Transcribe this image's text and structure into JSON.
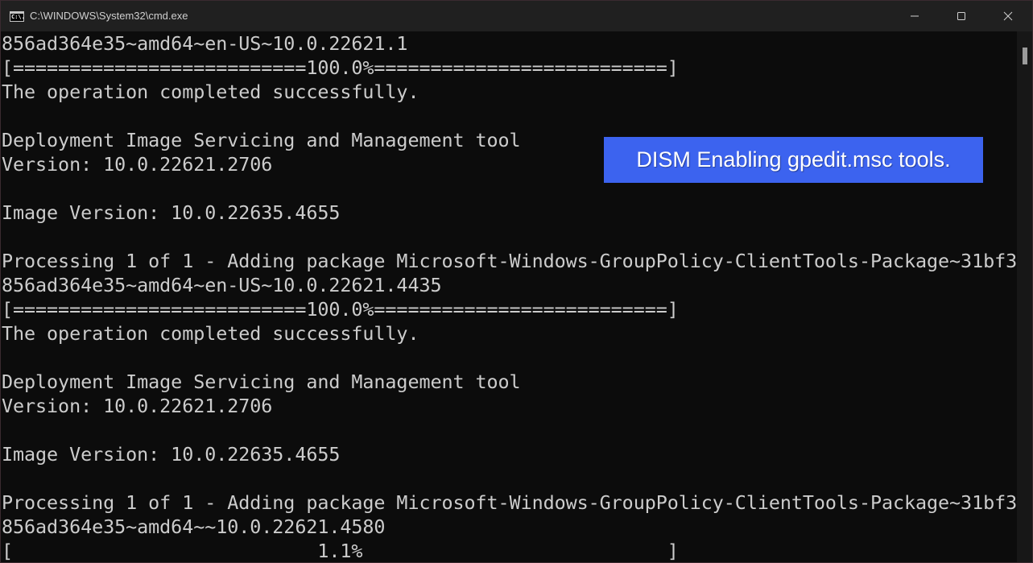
{
  "window": {
    "title": "C:\\WINDOWS\\System32\\cmd.exe",
    "app_icon_text": "C:\\.",
    "controls": {
      "minimize": "minimize",
      "maximize": "maximize",
      "close": "close"
    }
  },
  "terminal": {
    "lines": [
      "856ad364e35~amd64~en-US~10.0.22621.1",
      "[==========================100.0%==========================]",
      "The operation completed successfully.",
      "",
      "Deployment Image Servicing and Management tool",
      "Version: 10.0.22621.2706",
      "",
      "Image Version: 10.0.22635.4655",
      "",
      "Processing 1 of 1 - Adding package Microsoft-Windows-GroupPolicy-ClientTools-Package~31bf3",
      "856ad364e35~amd64~en-US~10.0.22621.4435",
      "[==========================100.0%==========================]",
      "The operation completed successfully.",
      "",
      "Deployment Image Servicing and Management tool",
      "Version: 10.0.22621.2706",
      "",
      "Image Version: 10.0.22635.4655",
      "",
      "Processing 1 of 1 - Adding package Microsoft-Windows-GroupPolicy-ClientTools-Package~31bf3",
      "856ad364e35~amd64~~10.0.22621.4580",
      "[                           1.1%                           ]"
    ],
    "current_progress_percent": 1.1
  },
  "overlay": {
    "caption": "DISM Enabling gpedit.msc tools.",
    "background_color": "#3c63ef"
  }
}
